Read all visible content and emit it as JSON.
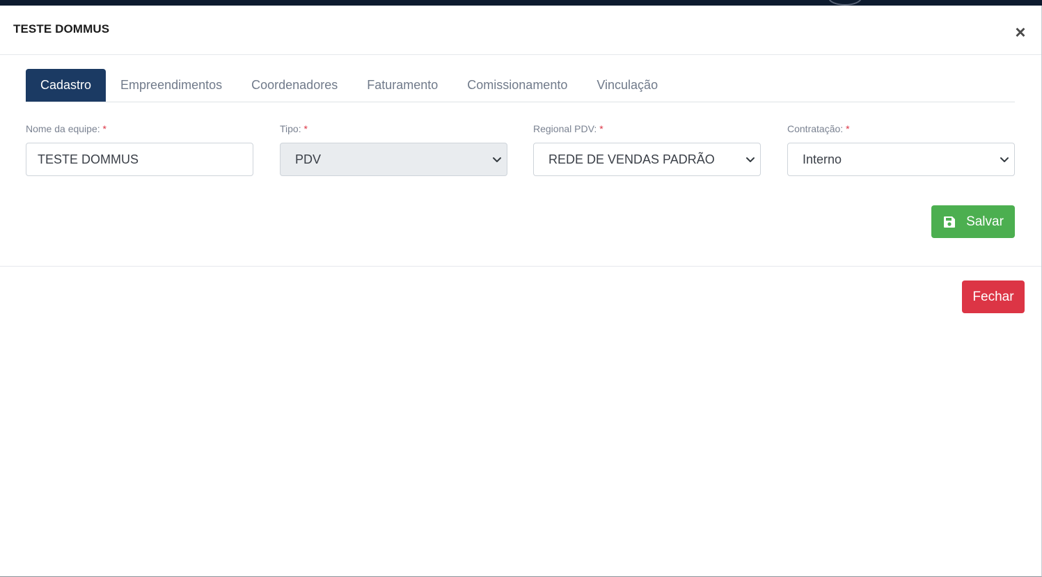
{
  "modal": {
    "title": "TESTE DOMMUS",
    "close_symbol": "×"
  },
  "tabs": [
    {
      "label": "Cadastro",
      "active": true
    },
    {
      "label": "Empreendimentos",
      "active": false
    },
    {
      "label": "Coordenadores",
      "active": false
    },
    {
      "label": "Faturamento",
      "active": false
    },
    {
      "label": "Comissionamento",
      "active": false
    },
    {
      "label": "Vinculação",
      "active": false
    }
  ],
  "form": {
    "nome": {
      "label": "Nome da equipe:",
      "required_mark": "*",
      "value": "TESTE DOMMUS"
    },
    "tipo": {
      "label": "Tipo:",
      "required_mark": "*",
      "value": "PDV",
      "disabled": true
    },
    "regional": {
      "label": "Regional PDV:",
      "required_mark": "*",
      "value": "REDE DE VENDAS PADRÃO"
    },
    "contratacao": {
      "label": "Contratação:",
      "required_mark": "*",
      "value": "Interno"
    }
  },
  "buttons": {
    "save_label": "Salvar",
    "close_label": "Fechar"
  },
  "colors": {
    "active_tab": "#1b3a63",
    "save": "#4caf50",
    "close": "#dc3545",
    "required": "#dc3545",
    "topbar": "#0d1b2e"
  },
  "icons": {
    "save": "floppy-disk-icon",
    "close": "close-icon",
    "select": "chevron-down-icon"
  }
}
